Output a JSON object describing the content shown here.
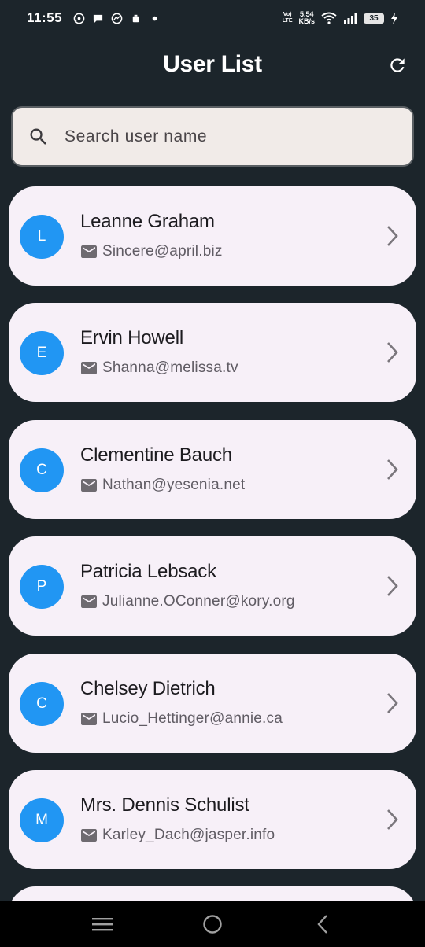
{
  "status_bar": {
    "time": "11:55",
    "volte_top": "Vo)",
    "volte_bottom": "LTE",
    "net_speed_value": "5.54",
    "net_speed_unit": "KB/s",
    "battery": "35",
    "left_icons": [
      "whatsapp-icon",
      "chat-icon",
      "messenger-icon",
      "notification-icon",
      "dot-icon"
    ],
    "right_icons": [
      "wifi-icon",
      "signal-icon",
      "battery-icon",
      "charging-icon"
    ]
  },
  "app_bar": {
    "title": "User List",
    "action_icon": "refresh-icon"
  },
  "search": {
    "placeholder": "Search user name",
    "icon": "search-icon"
  },
  "users": [
    {
      "initial": "L",
      "name": "Leanne Graham",
      "email": "Sincere@april.biz"
    },
    {
      "initial": "E",
      "name": "Ervin Howell",
      "email": "Shanna@melissa.tv"
    },
    {
      "initial": "C",
      "name": "Clementine Bauch",
      "email": "Nathan@yesenia.net"
    },
    {
      "initial": "P",
      "name": "Patricia Lebsack",
      "email": "Julianne.OConner@kory.org"
    },
    {
      "initial": "C",
      "name": "Chelsey Dietrich",
      "email": "Lucio_Hettinger@annie.ca"
    },
    {
      "initial": "M",
      "name": "Mrs. Dennis Schulist",
      "email": "Karley_Dach@jasper.info"
    }
  ],
  "colors": {
    "background": "#1c252b",
    "card": "#f7f0f8",
    "avatar": "#2196f3",
    "search_bg": "#f1ebe8"
  },
  "nav_bar": {
    "icons": [
      "menu-icon",
      "home-icon",
      "back-icon"
    ]
  }
}
